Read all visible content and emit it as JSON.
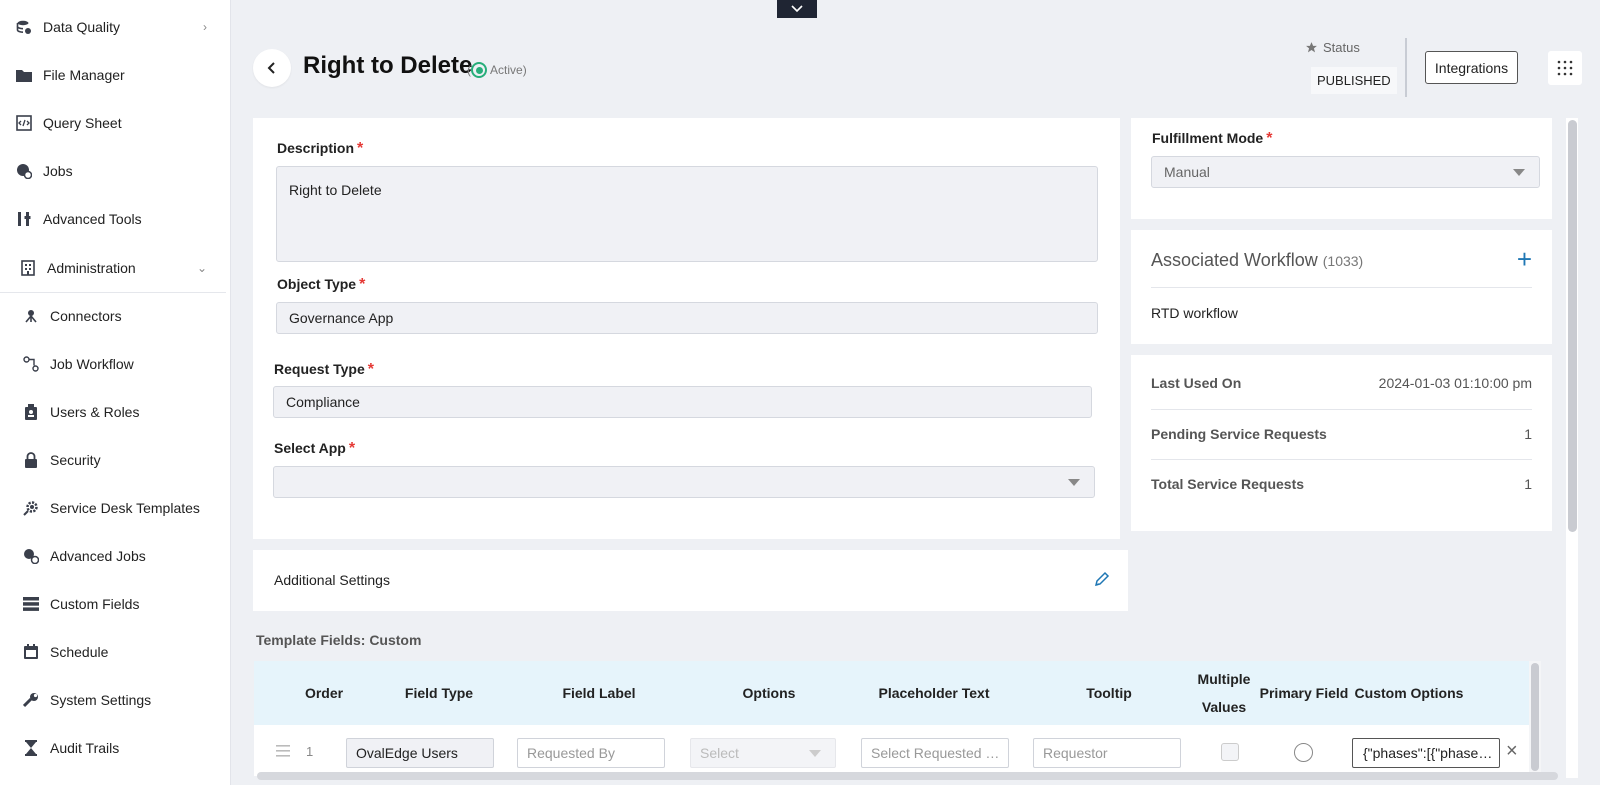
{
  "sidebar": {
    "items": [
      {
        "label": "Data Quality",
        "icon": "data-quality-icon",
        "chevron": "›"
      },
      {
        "label": "File Manager",
        "icon": "folder-icon"
      },
      {
        "label": "Query Sheet",
        "icon": "code-sheet-icon"
      },
      {
        "label": "Jobs",
        "icon": "jobs-icon"
      },
      {
        "label": "Advanced Tools",
        "icon": "tools-icon"
      },
      {
        "label": "Administration",
        "icon": "building-icon",
        "chevron": "⌄"
      }
    ],
    "sub_items": [
      {
        "label": "Connectors",
        "icon": "connectors-icon"
      },
      {
        "label": "Job Workflow",
        "icon": "workflow-icon"
      },
      {
        "label": "Users & Roles",
        "icon": "users-icon"
      },
      {
        "label": "Security",
        "icon": "lock-icon"
      },
      {
        "label": "Service Desk Templates",
        "icon": "gear-icon"
      },
      {
        "label": "Advanced Jobs",
        "icon": "advanced-jobs-icon"
      },
      {
        "label": "Custom Fields",
        "icon": "fields-icon"
      },
      {
        "label": "Schedule",
        "icon": "calendar-icon"
      },
      {
        "label": "System Settings",
        "icon": "wrench-icon"
      },
      {
        "label": "Audit Trails",
        "icon": "hourglass-icon"
      }
    ]
  },
  "header": {
    "title": "Right to Delete",
    "active_status": "Active",
    "active_paren_open": "(",
    "active_paren_close": ")",
    "status_label": "Status",
    "status_value": "PUBLISHED",
    "integrations_label": "Integrations"
  },
  "form": {
    "description_label": "Description",
    "description_value": "Right to Delete",
    "object_type_label": "Object Type",
    "object_type_value": "Governance App",
    "request_type_label": "Request Type",
    "request_type_value": "Compliance",
    "select_app_label": "Select App",
    "select_app_value": "",
    "required_mark": "*"
  },
  "additional_settings": {
    "label": "Additional Settings"
  },
  "fulfillment": {
    "label": "Fulfillment Mode",
    "value": "Manual"
  },
  "workflow": {
    "title": "Associated Workflow",
    "count": "(1033)",
    "add_label": "+",
    "item": "RTD workflow"
  },
  "stats": {
    "rows": [
      {
        "key": "Last Used On",
        "value": "2024-01-03 01:10:00 pm"
      },
      {
        "key": "Pending Service Requests",
        "value": "1"
      },
      {
        "key": "Total Service Requests",
        "value": "1"
      }
    ]
  },
  "table": {
    "title": "Template Fields: Custom",
    "headers": [
      "Order",
      "Field Type",
      "Field Label",
      "Options",
      "Placeholder Text",
      "Tooltip",
      "Multiple Values",
      "Primary Field",
      "Custom Options"
    ],
    "row": {
      "order": "1",
      "field_type": "OvalEdge Users",
      "field_label_placeholder": "Requested By",
      "options_placeholder": "Select",
      "placeholder_text": "Select Requested …",
      "tooltip_placeholder": "Requestor",
      "custom_options": "{\"phases\":[{\"phase…",
      "clear_label": "×"
    }
  },
  "colors": {
    "accent": "#1f77b4",
    "active": "#27ae7a",
    "required": "#e53935",
    "table_header": "#e6f4fb"
  }
}
